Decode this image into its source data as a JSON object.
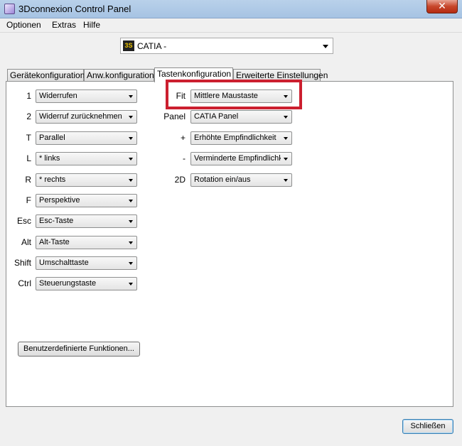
{
  "window": {
    "title": "3Dconnexion Control Panel",
    "close_glyph": "✕"
  },
  "menu": [
    "Optionen",
    "Extras",
    "Hilfe"
  ],
  "application": {
    "value": "CATIA -",
    "logo_text": "3S"
  },
  "tabs": [
    "Gerätekonfiguration",
    "Anw.konfiguration",
    "Tastenkonfiguration",
    "Erweiterte Einstellungen"
  ],
  "left_buttons": [
    {
      "label": "1",
      "value": "Widerrufen"
    },
    {
      "label": "2",
      "value": "Widerruf zurücknehmen"
    },
    {
      "label": "T",
      "value": "Parallel"
    },
    {
      "label": "L",
      "value": "* links"
    },
    {
      "label": "R",
      "value": "* rechts"
    },
    {
      "label": "F",
      "value": "Perspektive"
    },
    {
      "label": "Esc",
      "value": "Esc-Taste"
    },
    {
      "label": "Alt",
      "value": "Alt-Taste"
    },
    {
      "label": "Shift",
      "value": "Umschalttaste"
    },
    {
      "label": "Ctrl",
      "value": "Steuerungstaste"
    }
  ],
  "right_buttons": [
    {
      "label": "Fit",
      "value": "Mittlere Maustaste"
    },
    {
      "label": "Panel",
      "value": "CATIA Panel"
    },
    {
      "label": "+",
      "value": "Erhöhte Empfindlichkeit"
    },
    {
      "label": "-",
      "value": "Verminderte Empfindlichk"
    },
    {
      "label": "2D",
      "value": "Rotation ein/aus"
    }
  ],
  "custom_functions_label": "Benutzerdefinierte Funktionen...",
  "close_label": "Schließen",
  "colors": {
    "highlight": "#cc1f2f",
    "titlebar": "#b9d1ea"
  }
}
